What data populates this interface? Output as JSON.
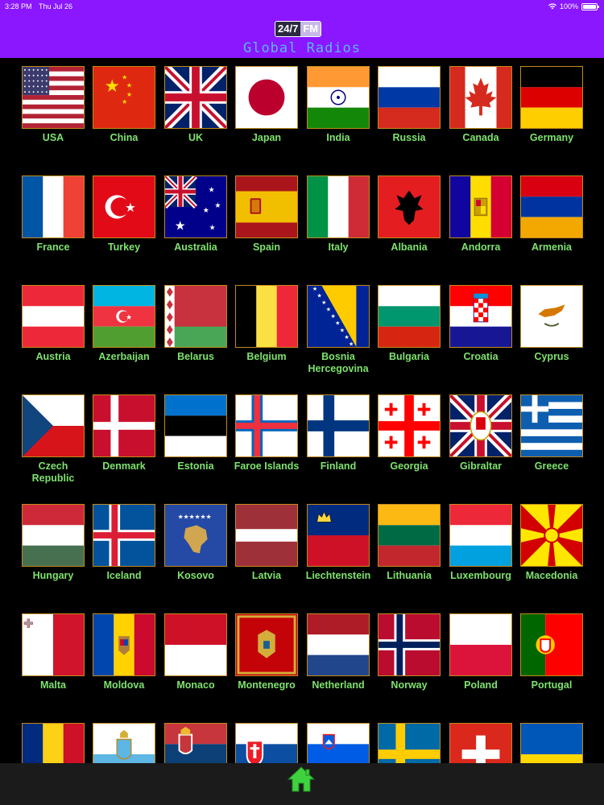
{
  "status_bar": {
    "time": "3:28 PM",
    "date": "Thu Jul 26",
    "battery": "100%"
  },
  "app": {
    "logo_left": "24/7",
    "logo_right": "FM",
    "title": "Global Radios"
  },
  "countries": [
    {
      "name": "USA",
      "flag": "usa-flag-icon"
    },
    {
      "name": "China",
      "flag": "china-flag-icon"
    },
    {
      "name": "UK",
      "flag": "uk-flag-icon"
    },
    {
      "name": "Japan",
      "flag": "japan-flag-icon"
    },
    {
      "name": "India",
      "flag": "india-flag-icon"
    },
    {
      "name": "Russia",
      "flag": "russia-flag-icon"
    },
    {
      "name": "Canada",
      "flag": "canada-flag-icon"
    },
    {
      "name": "Germany",
      "flag": "germany-flag-icon"
    },
    {
      "name": "France",
      "flag": "france-flag-icon"
    },
    {
      "name": "Turkey",
      "flag": "turkey-flag-icon"
    },
    {
      "name": "Australia",
      "flag": "australia-flag-icon"
    },
    {
      "name": "Spain",
      "flag": "spain-flag-icon"
    },
    {
      "name": "Italy",
      "flag": "italy-flag-icon"
    },
    {
      "name": "Albania",
      "flag": "albania-flag-icon"
    },
    {
      "name": "Andorra",
      "flag": "andorra-flag-icon"
    },
    {
      "name": "Armenia",
      "flag": "armenia-flag-icon"
    },
    {
      "name": "Austria",
      "flag": "austria-flag-icon"
    },
    {
      "name": "Azerbaijan",
      "flag": "azerbaijan-flag-icon"
    },
    {
      "name": "Belarus",
      "flag": "belarus-flag-icon"
    },
    {
      "name": "Belgium",
      "flag": "belgium-flag-icon"
    },
    {
      "name": "Bosnia Hercegovina",
      "flag": "bosnia-flag-icon"
    },
    {
      "name": "Bulgaria",
      "flag": "bulgaria-flag-icon"
    },
    {
      "name": "Croatia",
      "flag": "croatia-flag-icon"
    },
    {
      "name": "Cyprus",
      "flag": "cyprus-flag-icon"
    },
    {
      "name": "Czech Republic",
      "flag": "czech-flag-icon"
    },
    {
      "name": "Denmark",
      "flag": "denmark-flag-icon"
    },
    {
      "name": "Estonia",
      "flag": "estonia-flag-icon"
    },
    {
      "name": "Faroe Islands",
      "flag": "faroe-flag-icon"
    },
    {
      "name": "Finland",
      "flag": "finland-flag-icon"
    },
    {
      "name": "Georgia",
      "flag": "georgia-flag-icon"
    },
    {
      "name": "Gibraltar",
      "flag": "gibraltar-flag-icon"
    },
    {
      "name": "Greece",
      "flag": "greece-flag-icon"
    },
    {
      "name": "Hungary",
      "flag": "hungary-flag-icon"
    },
    {
      "name": "Iceland",
      "flag": "iceland-flag-icon"
    },
    {
      "name": "Kosovo",
      "flag": "kosovo-flag-icon"
    },
    {
      "name": "Latvia",
      "flag": "latvia-flag-icon"
    },
    {
      "name": "Liechtenstein",
      "flag": "liechtenstein-flag-icon"
    },
    {
      "name": "Lithuania",
      "flag": "lithuania-flag-icon"
    },
    {
      "name": "Luxembourg",
      "flag": "luxembourg-flag-icon"
    },
    {
      "name": "Macedonia",
      "flag": "macedonia-flag-icon"
    },
    {
      "name": "Malta",
      "flag": "malta-flag-icon"
    },
    {
      "name": "Moldova",
      "flag": "moldova-flag-icon"
    },
    {
      "name": "Monaco",
      "flag": "monaco-flag-icon"
    },
    {
      "name": "Montenegro",
      "flag": "montenegro-flag-icon"
    },
    {
      "name": "Netherland",
      "flag": "netherlands-flag-icon"
    },
    {
      "name": "Norway",
      "flag": "norway-flag-icon"
    },
    {
      "name": "Poland",
      "flag": "poland-flag-icon"
    },
    {
      "name": "Portugal",
      "flag": "portugal-flag-icon"
    },
    {
      "name": "",
      "flag": "romania-flag-icon"
    },
    {
      "name": "",
      "flag": "san-marino-flag-icon"
    },
    {
      "name": "",
      "flag": "serbia-flag-icon"
    },
    {
      "name": "",
      "flag": "slovakia-flag-icon"
    },
    {
      "name": "",
      "flag": "slovenia-flag-icon"
    },
    {
      "name": "",
      "flag": "sweden-flag-icon"
    },
    {
      "name": "",
      "flag": "switzerland-flag-icon"
    },
    {
      "name": "",
      "flag": "ukraine-flag-icon"
    }
  ],
  "bottom_nav": {
    "home_icon": "home-icon"
  },
  "colors": {
    "header": "#8a17ff",
    "label": "#7ee36d",
    "title": "#5ab7ff",
    "background": "#000000"
  }
}
